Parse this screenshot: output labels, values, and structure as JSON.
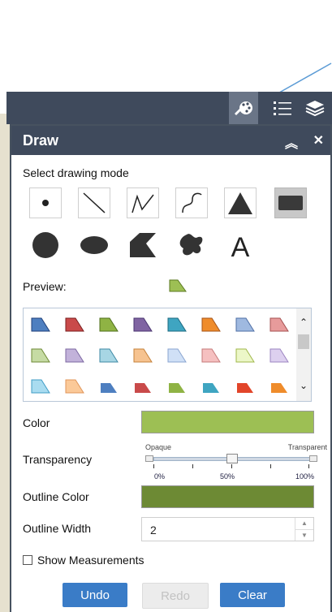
{
  "panel": {
    "title": "Draw",
    "select_mode_label": "Select drawing mode",
    "preview_label": "Preview:",
    "color_label": "Color",
    "transparency_label": "Transparency",
    "opaque_label": "Opaque",
    "transparent_label": "Transparent",
    "ticks": [
      "0%",
      "50%",
      "100%"
    ],
    "transparency_value_fraction": 0.5,
    "outline_color_label": "Outline Color",
    "outline_width_label": "Outline Width",
    "outline_width_value": "2",
    "show_measurements_label": "Show Measurements",
    "show_measurements_checked": false,
    "buttons": {
      "undo": "Undo",
      "redo": "Redo",
      "clear": "Clear"
    }
  },
  "drawing_modes": [
    "point",
    "line",
    "polyline",
    "freehand-polyline",
    "triangle",
    "rectangle",
    "circle",
    "ellipse",
    "polygon",
    "freehand-polygon",
    "text"
  ],
  "selected_mode": "rectangle",
  "colors": {
    "fill": "#9dbf54",
    "outline": "#6d8a34",
    "header": "#3f4a5c",
    "button": "#3a7cc7",
    "button_disabled": "#e0e0e0"
  },
  "toolbar_icons": [
    "draw-icon",
    "list-icon",
    "layers-icon"
  ]
}
